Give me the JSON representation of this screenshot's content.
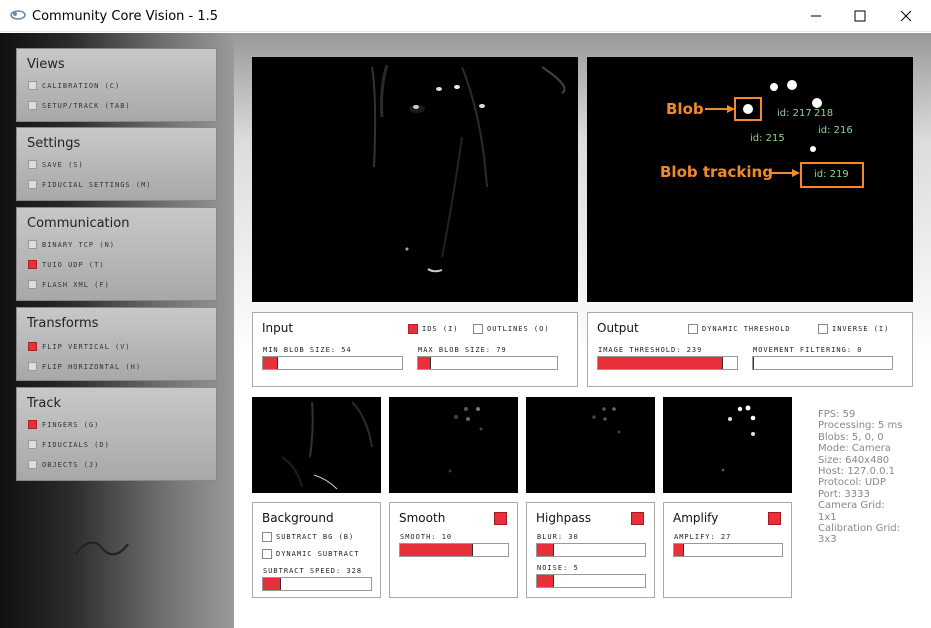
{
  "window": {
    "title": "Community Core Vision - 1.5"
  },
  "sidebar": {
    "views": {
      "title": "Views",
      "items": [
        {
          "label": "CALIBRATION (C)",
          "checked": false
        },
        {
          "label": "SETUP/TRACK (TAB)",
          "checked": false
        }
      ]
    },
    "settings": {
      "title": "Settings",
      "items": [
        {
          "label": "SAVE (S)",
          "checked": false
        },
        {
          "label": "FIDUCIAL SETTINGS (M)",
          "checked": false
        }
      ]
    },
    "communication": {
      "title": "Communication",
      "items": [
        {
          "label": "BINARY TCP (N)",
          "checked": false
        },
        {
          "label": "TUIO UDP (T)",
          "checked": true
        },
        {
          "label": "FLASH XML (F)",
          "checked": false
        }
      ]
    },
    "transforms": {
      "title": "Transforms",
      "items": [
        {
          "label": "FLIP VERTICAL (V)",
          "checked": true
        },
        {
          "label": "FLIP HORIZONTAL (H)",
          "checked": false
        }
      ]
    },
    "track": {
      "title": "Track",
      "items": [
        {
          "label": "FINGERS (G)",
          "checked": true
        },
        {
          "label": "FIDUCIALS (D)",
          "checked": false
        },
        {
          "label": "OBJECTS (J)",
          "checked": false
        }
      ]
    }
  },
  "input": {
    "title": "Input",
    "ids_label": "IDS (I)",
    "ids_checked": true,
    "outlines_label": "OUTLINES (O)",
    "outlines_checked": false,
    "min_blob_label": "MIN BLOB SIZE: 54",
    "min_blob_fraction": 0.11,
    "max_blob_label": "MAX BLOB SIZE: 79",
    "max_blob_fraction": 0.09
  },
  "output": {
    "title": "Output",
    "dynamic_threshold_label": "DYNAMIC THRESHOLD",
    "dynamic_threshold_checked": false,
    "inverse_label": "INVERSE (I)",
    "inverse_checked": false,
    "image_threshold_label": "IMAGE THRESHOLD: 239",
    "image_threshold_fraction": 0.9,
    "movement_filtering_label": "MOVEMENT FILTERING: 0",
    "movement_filtering_fraction": 0.0
  },
  "filters": {
    "background": {
      "title": "Background",
      "subtract_bg_label": "SUBTRACT BG (B)",
      "subtract_bg_checked": false,
      "dynamic_subtract_label": "DYNAMIC SUBTRACT",
      "dynamic_subtract_checked": false,
      "subtract_speed_label": "SUBTRACT SPEED: 328",
      "subtract_speed_fraction": 0.17
    },
    "smooth": {
      "title": "Smooth",
      "enabled": true,
      "smooth_label": "SMOOTH: 10",
      "smooth_fraction": 0.68
    },
    "highpass": {
      "title": "Highpass",
      "enabled": true,
      "blur_label": "BLUR: 30",
      "blur_fraction": 0.16,
      "noise_label": "NOISE: 5",
      "noise_fraction": 0.16
    },
    "amplify": {
      "title": "Amplify",
      "enabled": true,
      "amplify_label": "AMPLIFY: 27",
      "amplify_fraction": 0.09
    }
  },
  "stats": {
    "fps": "FPS: 59",
    "processing": "Processing: 5 ms",
    "blobs": "Blobs: 5, 0, 0",
    "mode": "Mode: Camera",
    "size": "Size: 640x480",
    "host": "Host: 127.0.0.1",
    "protocol": "Protocol: UDP",
    "port": "Port: 3333",
    "camera_grid_label": "Camera Grid:",
    "camera_grid_value": "1x1",
    "calibration_grid_label": "Calibration Grid:",
    "calibration_grid_value": "3x3"
  },
  "annotations": {
    "blob": "Blob",
    "blob_tracking": "Blob tracking",
    "id_217": "id: 217",
    "id_218": "218",
    "id_215": "id: 215",
    "id_216": "id: 216",
    "id_219": "id: 219"
  },
  "colors": {
    "accent_red": "#e8303a",
    "annotation_orange": "#f28a2b",
    "id_green": "#8fd08f"
  }
}
